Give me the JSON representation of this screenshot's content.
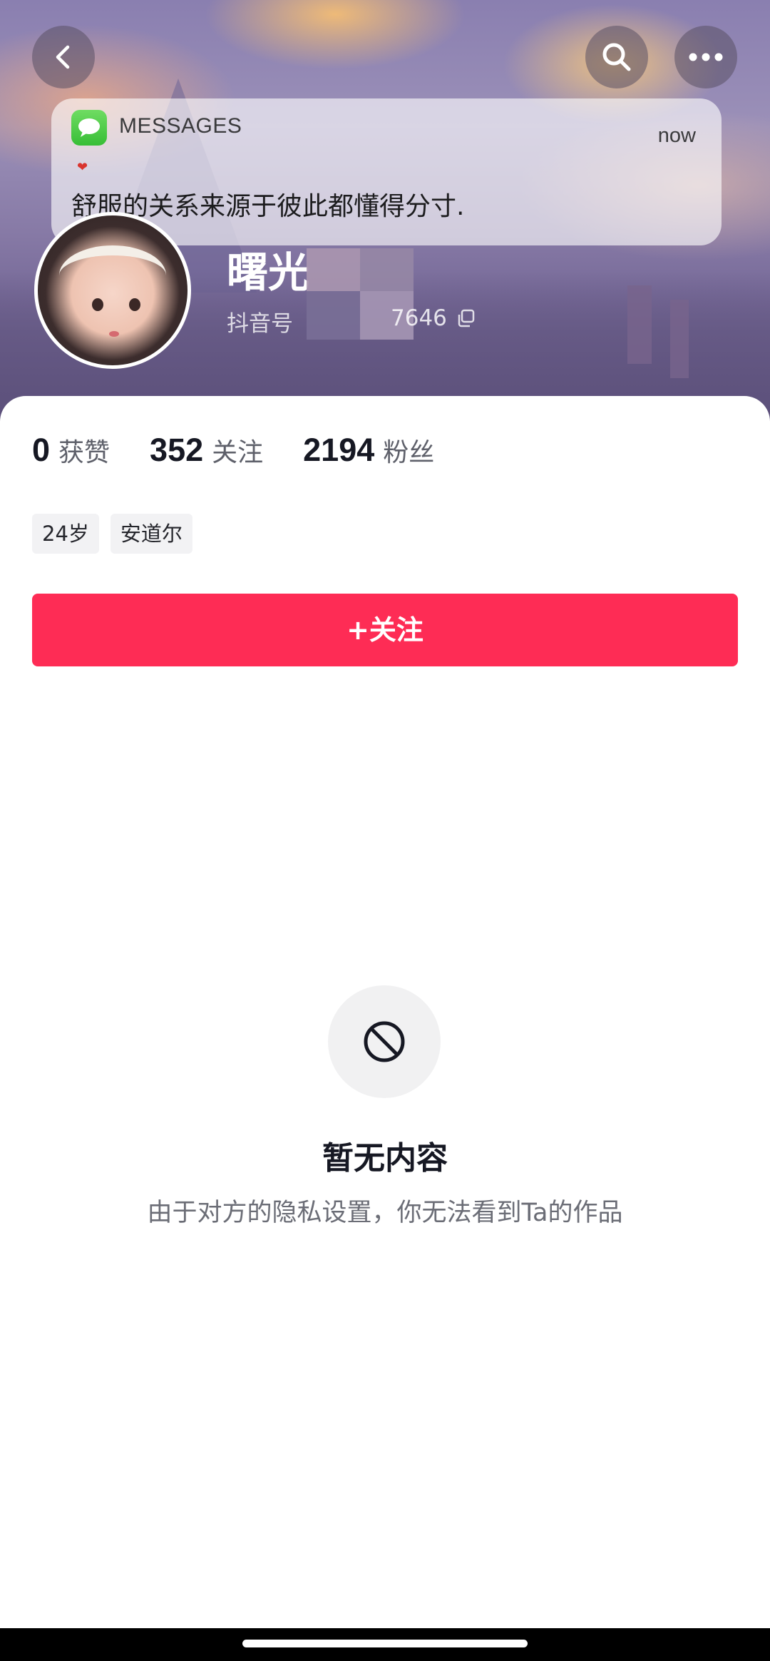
{
  "header": {
    "back_icon": "chevron-left-icon",
    "search_icon": "search-icon",
    "more_icon": "more-horizontal-icon"
  },
  "notification": {
    "app_name": "MESSAGES",
    "time": "now",
    "body": "舒服的关系来源于彼此都懂得分寸."
  },
  "profile": {
    "username": "曙光",
    "douyin_id_prefix": "抖音号",
    "douyin_id_tail": "7646"
  },
  "stats": [
    {
      "value": "0",
      "label": "获赞"
    },
    {
      "value": "352",
      "label": "关注"
    },
    {
      "value": "2194",
      "label": "粉丝"
    }
  ],
  "tags": [
    "24岁",
    "安道尔"
  ],
  "follow_button": "+关注",
  "empty_state": {
    "icon": "no-entry-icon",
    "title": "暂无内容",
    "description": "由于对方的隐私设置，你无法看到Ta的作品"
  },
  "colors": {
    "accent": "#fe2c55",
    "text_primary": "#161823",
    "text_secondary": "#6b6d76"
  }
}
